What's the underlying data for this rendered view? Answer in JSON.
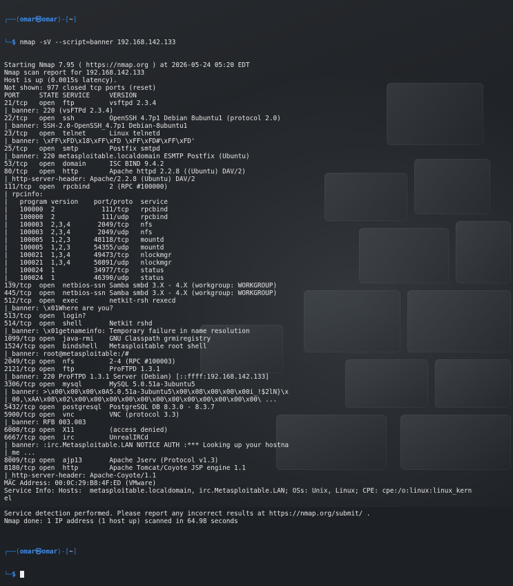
{
  "prompt": {
    "user": "omar",
    "symbol": "㉿",
    "host": "omar",
    "cwd": "~",
    "colors": {
      "prompt": "#3f8ef0",
      "text": "#e6e6e6",
      "background": "#1d2024"
    }
  },
  "command": "nmap -sV --script=banner 192.168.142.133",
  "output_lines": [
    "Starting Nmap 7.95 ( https://nmap.org ) at 2026-05-24 05:20 EDT",
    "Nmap scan report for 192.168.142.133",
    "Host is up (0.0015s latency).",
    "Not shown: 977 closed tcp ports (reset)",
    "PORT     STATE SERVICE     VERSION",
    "21/tcp   open  ftp         vsftpd 2.3.4",
    "|_banner: 220 (vsFTPd 2.3.4)",
    "22/tcp   open  ssh         OpenSSH 4.7p1 Debian 8ubuntu1 (protocol 2.0)",
    "|_banner: SSH-2.0-OpenSSH_4.7p1 Debian-8ubuntu1",
    "23/tcp   open  telnet      Linux telnetd",
    "|_banner: \\xFF\\xFD\\x18\\xFF\\xFD \\xFF\\xFD#\\xFF\\xFD'",
    "25/tcp   open  smtp        Postfix smtpd",
    "|_banner: 220 metasploitable.localdomain ESMTP Postfix (Ubuntu)",
    "53/tcp   open  domain      ISC BIND 9.4.2",
    "80/tcp   open  http        Apache httpd 2.2.8 ((Ubuntu) DAV/2)",
    "|_http-server-header: Apache/2.2.8 (Ubuntu) DAV/2",
    "111/tcp  open  rpcbind     2 (RPC #100000)",
    "| rpcinfo:",
    "|   program version    port/proto  service",
    "|   100000  2            111/tcp   rpcbind",
    "|   100000  2            111/udp   rpcbind",
    "|   100003  2,3,4       2049/tcp   nfs",
    "|   100003  2,3,4       2049/udp   nfs",
    "|   100005  1,2,3      48118/tcp   mountd",
    "|   100005  1,2,3      54355/udp   mountd",
    "|   100021  1,3,4      49473/tcp   nlockmgr",
    "|   100021  1,3,4      50891/udp   nlockmgr",
    "|   100024  1          34977/tcp   status",
    "|_  100024  1          46390/udp   status",
    "139/tcp  open  netbios-ssn Samba smbd 3.X - 4.X (workgroup: WORKGROUP)",
    "445/tcp  open  netbios-ssn Samba smbd 3.X - 4.X (workgroup: WORKGROUP)",
    "512/tcp  open  exec        netkit-rsh rexecd",
    "|_banner: \\x01Where are you?",
    "513/tcp  open  login?",
    "514/tcp  open  shell       Netkit rshd",
    "|_banner: \\x01getnameinfo: Temporary failure in name resolution",
    "1099/tcp open  java-rmi    GNU Classpath grmiregistry",
    "1524/tcp open  bindshell   Metasploitable root shell",
    "|_banner: root@metasploitable:/#",
    "2049/tcp open  nfs         2-4 (RPC #100003)",
    "2121/tcp open  ftp         ProFTPD 1.3.1",
    "|_banner: 220 ProFTPD 1.3.1 Server (Debian) [::ffff:192.168.142.133]",
    "3306/tcp open  mysql       MySQL 5.0.51a-3ubuntu5",
    "| banner: >\\x00\\x00\\x00\\x0A5.0.51a-3ubuntu5\\x00\\x08\\x00\\x00\\x00i_!$2lN}\\x",
    "|_00,\\xAA\\x08\\x02\\x00\\x00\\x00\\x00\\x00\\x00\\x00\\x00\\x00\\x00\\x00\\x00\\ ...",
    "5432/tcp open  postgresql  PostgreSQL DB 8.3.0 - 8.3.7",
    "5900/tcp open  vnc         VNC (protocol 3.3)",
    "|_banner: RFB 003.003",
    "6000/tcp open  X11         (access denied)",
    "6667/tcp open  irc         UnrealIRCd",
    "| banner: :irc.Metasploitable.LAN NOTICE AUTH :*** Looking up your hostna",
    "|_me ...",
    "8009/tcp open  ajp13       Apache Jserv (Protocol v1.3)",
    "8180/tcp open  http        Apache Tomcat/Coyote JSP engine 1.1",
    "|_http-server-header: Apache-Coyote/1.1",
    "MAC Address: 00:0C:29:B8:4F:ED (VMware)",
    "Service Info: Hosts:  metasploitable.localdomain, irc.Metasploitable.LAN; OSs: Unix, Linux; CPE: cpe:/o:linux:linux_kern",
    "el",
    "",
    "Service detection performed. Please report any incorrect results at https://nmap.org/submit/ .",
    "Nmap done: 1 IP address (1 host up) scanned in 64.98 seconds",
    ""
  ]
}
